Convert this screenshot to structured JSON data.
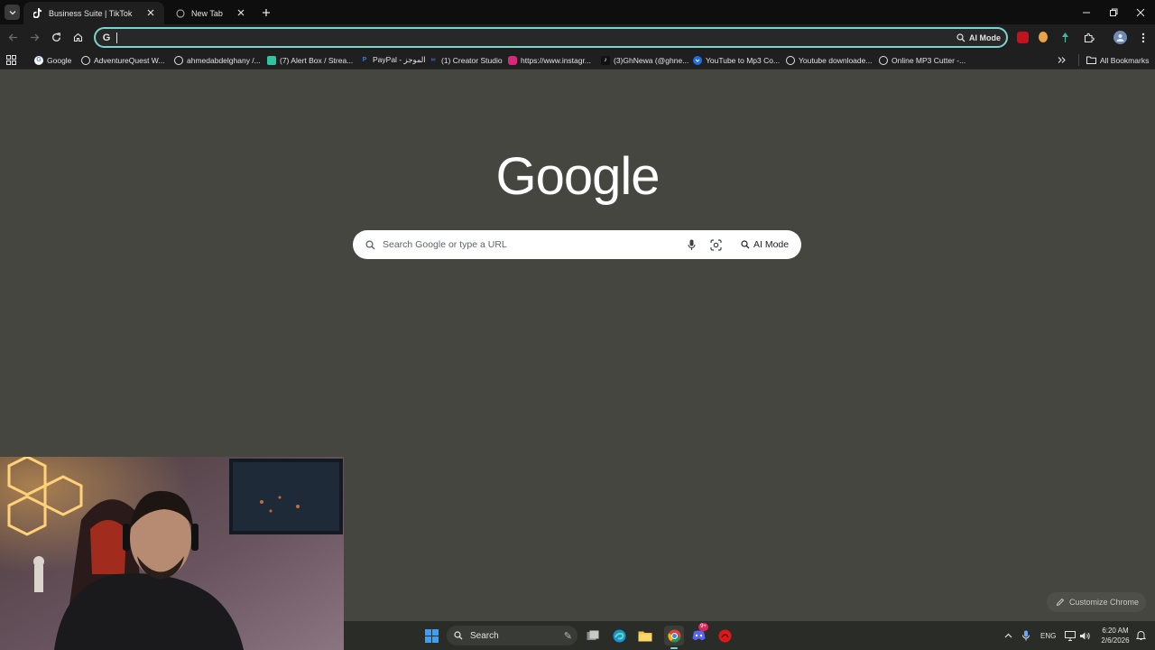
{
  "tabs": [
    {
      "title": "Business Suite | TikTok",
      "active": true
    },
    {
      "title": "New Tab",
      "active": false
    }
  ],
  "omnibox": {
    "value": "",
    "ai_label": "AI Mode"
  },
  "bookmarks": [
    {
      "label": "Google",
      "icon": "google-icon"
    },
    {
      "label": "AdventureQuest W...",
      "icon": "globe-icon"
    },
    {
      "label": "ahmedabdelghany /...",
      "icon": "globe-icon"
    },
    {
      "label": "(7) Alert Box / Strea...",
      "icon": "streamlabs-icon"
    },
    {
      "label": "PayPal - الموجز",
      "icon": "paypal-icon"
    },
    {
      "label": "(1) Creator Studio",
      "icon": "meta-icon"
    },
    {
      "label": "https://www.instagr...",
      "icon": "instagram-icon"
    },
    {
      "label": "(3)GhNewa (@ghne...",
      "icon": "tiktok-icon"
    },
    {
      "label": "YouTube to Mp3 Co...",
      "icon": "download-icon"
    },
    {
      "label": "Youtube downloade...",
      "icon": "globe-icon"
    },
    {
      "label": "Online MP3 Cutter -...",
      "icon": "globe-icon"
    }
  ],
  "all_bookmarks": "All Bookmarks",
  "logo": "Google",
  "search": {
    "placeholder": "Search Google or type a URL",
    "ai_label": "AI Mode"
  },
  "customize": "Customize Chrome",
  "taskbar": {
    "search": "Search",
    "lang": "ENG",
    "time": "6:20 AM",
    "date": "2/6/2026",
    "discord_badge": "9+"
  },
  "colors": {
    "accent": "#7ad3cf",
    "background": "#45463f",
    "toolbar": "#1f1f1f"
  }
}
